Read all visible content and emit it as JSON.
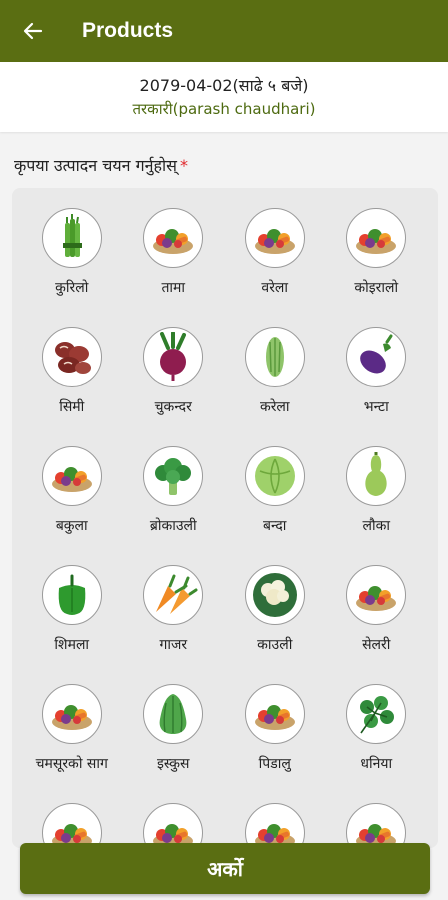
{
  "app": {
    "title": "Products",
    "back_icon": "arrow-left-icon"
  },
  "info": {
    "date_line": "2079-04-02(साढे ५ बजे)",
    "category_line": "तरकारी(parash  chaudhari)"
  },
  "prompt": {
    "label": "कृपया उत्पादन चयन गर्नुहोस्",
    "required_mark": "*"
  },
  "products": [
    {
      "label": "कुरिलो",
      "icon": "asparagus-icon"
    },
    {
      "label": "तामा",
      "icon": "mixed-vegetables-icon"
    },
    {
      "label": "वरेला",
      "icon": "mixed-vegetables-icon"
    },
    {
      "label": "कोइरालो",
      "icon": "mixed-vegetables-icon"
    },
    {
      "label": "सिमी",
      "icon": "kidney-beans-icon"
    },
    {
      "label": "चुकन्दर",
      "icon": "beetroot-icon"
    },
    {
      "label": "करेला",
      "icon": "bitter-gourd-icon"
    },
    {
      "label": "भन्टा",
      "icon": "eggplant-icon"
    },
    {
      "label": "बकुला",
      "icon": "mixed-vegetables-icon"
    },
    {
      "label": "ब्रोकाउली",
      "icon": "broccoli-icon"
    },
    {
      "label": "बन्दा",
      "icon": "cabbage-icon"
    },
    {
      "label": "लौका",
      "icon": "bottle-gourd-icon"
    },
    {
      "label": "शिमला",
      "icon": "capsicum-icon"
    },
    {
      "label": "गाजर",
      "icon": "carrot-icon"
    },
    {
      "label": "काउली",
      "icon": "cauliflower-icon"
    },
    {
      "label": "सेलरी",
      "icon": "mixed-vegetables-icon"
    },
    {
      "label": "चमसूरको साग",
      "icon": "mixed-vegetables-icon"
    },
    {
      "label": "इस्कुस",
      "icon": "chayote-icon"
    },
    {
      "label": "पिडालु",
      "icon": "mixed-vegetables-icon"
    },
    {
      "label": "धनिया",
      "icon": "coriander-icon"
    },
    {
      "label": "",
      "icon": "mixed-vegetables-icon"
    },
    {
      "label": "",
      "icon": "mixed-vegetables-icon"
    },
    {
      "label": "",
      "icon": "mixed-vegetables-icon"
    },
    {
      "label": "",
      "icon": "mixed-vegetables-icon"
    }
  ],
  "footer": {
    "next_label": "अर्को"
  },
  "colors": {
    "primary": "#5a6e12",
    "accent_text": "#4d6a10",
    "required": "#e0282c"
  }
}
